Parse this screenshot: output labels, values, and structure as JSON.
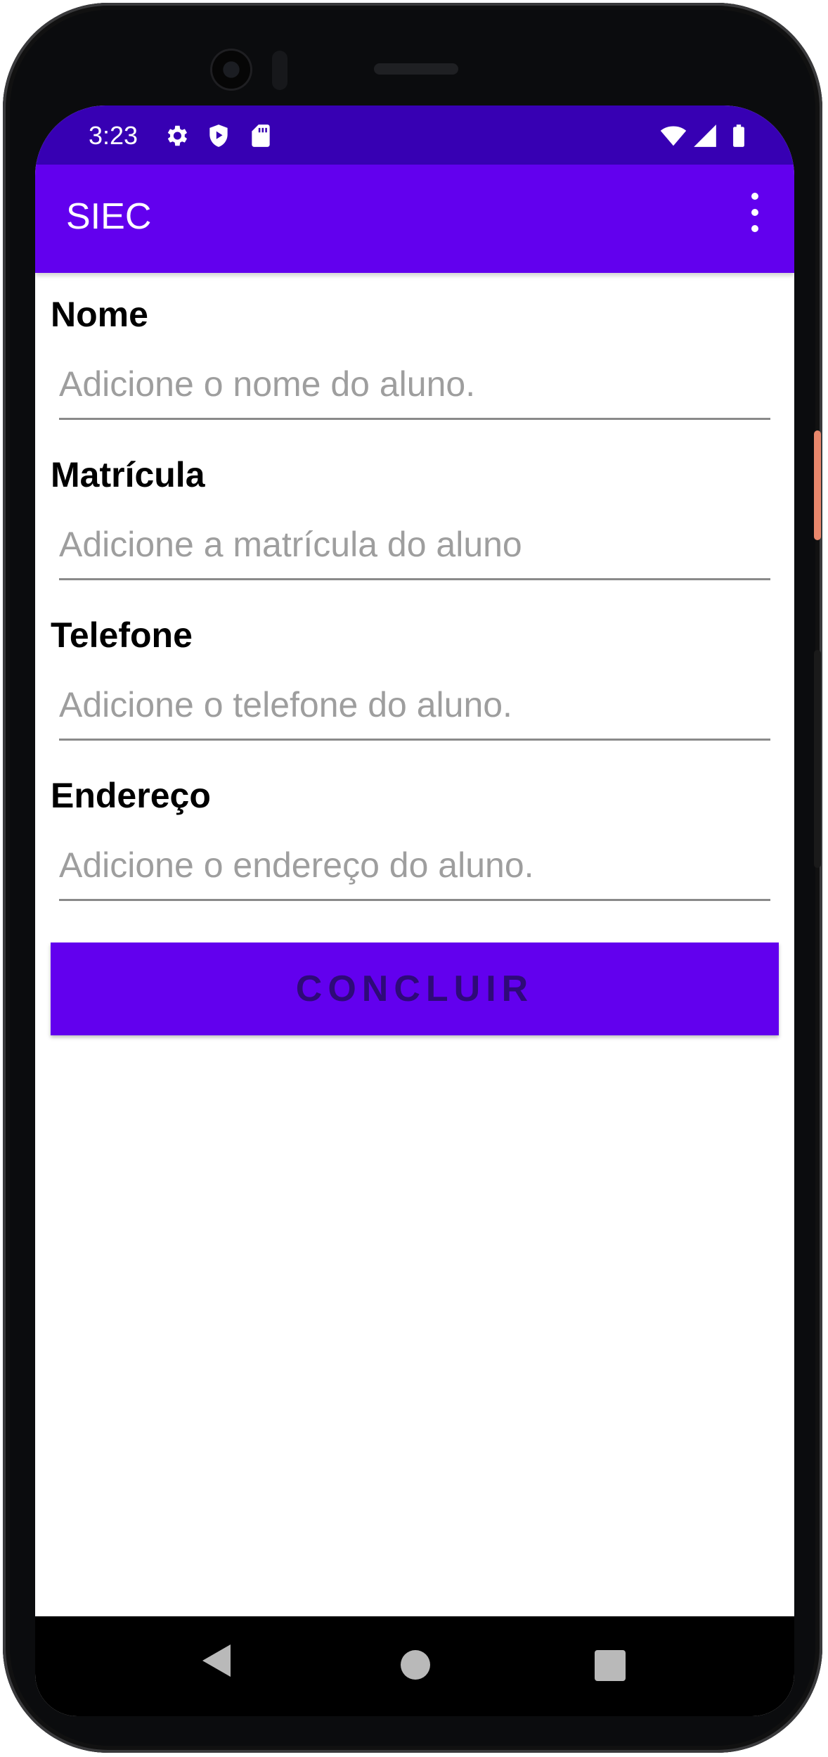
{
  "statusbar": {
    "time": "3:23",
    "left_icons": [
      "gear-icon",
      "shield-play-icon",
      "sd-card-icon"
    ],
    "right_icons": [
      "wifi-icon",
      "signal-icon",
      "battery-icon"
    ]
  },
  "appbar": {
    "title": "SIEC",
    "menu_icon": "more-vert-icon"
  },
  "form": {
    "fields": [
      {
        "label": "Nome",
        "value": "",
        "placeholder": "Adicione o nome do aluno."
      },
      {
        "label": "Matrícula",
        "value": "",
        "placeholder": "Adicione a matrícula do aluno"
      },
      {
        "label": "Telefone",
        "value": "",
        "placeholder": "Adicione o telefone do aluno."
      },
      {
        "label": "Endereço",
        "value": "",
        "placeholder": "Adicione o endereço do aluno."
      }
    ],
    "submit_label": "CONCLUIR"
  },
  "navbar": {
    "icons": [
      "back-icon",
      "home-icon",
      "recents-icon"
    ]
  },
  "colors": {
    "statusbar": "#3700b3",
    "primary": "#6200ee",
    "button_text": "#2e0a78",
    "placeholder": "#9e9e9e"
  }
}
